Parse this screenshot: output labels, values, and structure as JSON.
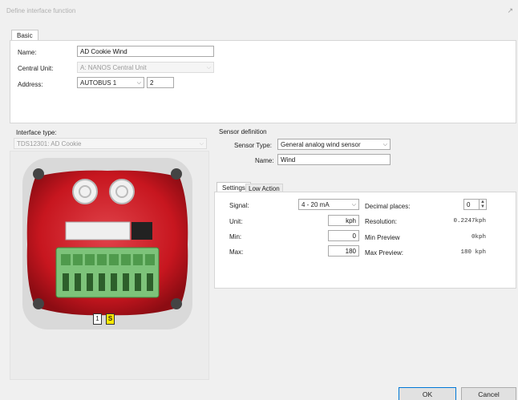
{
  "window": {
    "title": "Define interface function"
  },
  "tabs": {
    "basic": "Basic"
  },
  "basic": {
    "name_label": "Name:",
    "name_value": "AD Cookie Wind",
    "central_unit_label": "Central Unit:",
    "central_unit_value": "A: NANOS Central Unit",
    "address_label": "Address:",
    "address_bus": "AUTOBUS 1",
    "address_number": "2"
  },
  "interface": {
    "label": "Interface type:",
    "value": "TDS12301: AD Cookie",
    "slot_number": "1",
    "slot_letter": "S"
  },
  "sensor": {
    "section_label": "Sensor definition",
    "type_label": "Sensor Type:",
    "type_value": "General analog wind sensor",
    "name_label": "Name:",
    "name_value": "Wind"
  },
  "settings_tabs": {
    "settings": "Settings",
    "low_action": "Low Action"
  },
  "settings": {
    "signal_label": "Signal:",
    "signal_value": "4 - 20 mA",
    "unit_label": "Unit:",
    "unit_value": "kph",
    "min_label": "Min:",
    "min_value": "0",
    "max_label": "Max:",
    "max_value": "180",
    "decimal_label": "Decimal places:",
    "decimal_value": "0",
    "resolution_label": "Resolution:",
    "resolution_value": "0.2247kph",
    "min_preview_label": "Min Preview",
    "min_preview_value": "0kph",
    "max_preview_label": "Max Preview:",
    "max_preview_value": "180 kph"
  },
  "buttons": {
    "ok": "OK",
    "cancel": "Cancel"
  }
}
